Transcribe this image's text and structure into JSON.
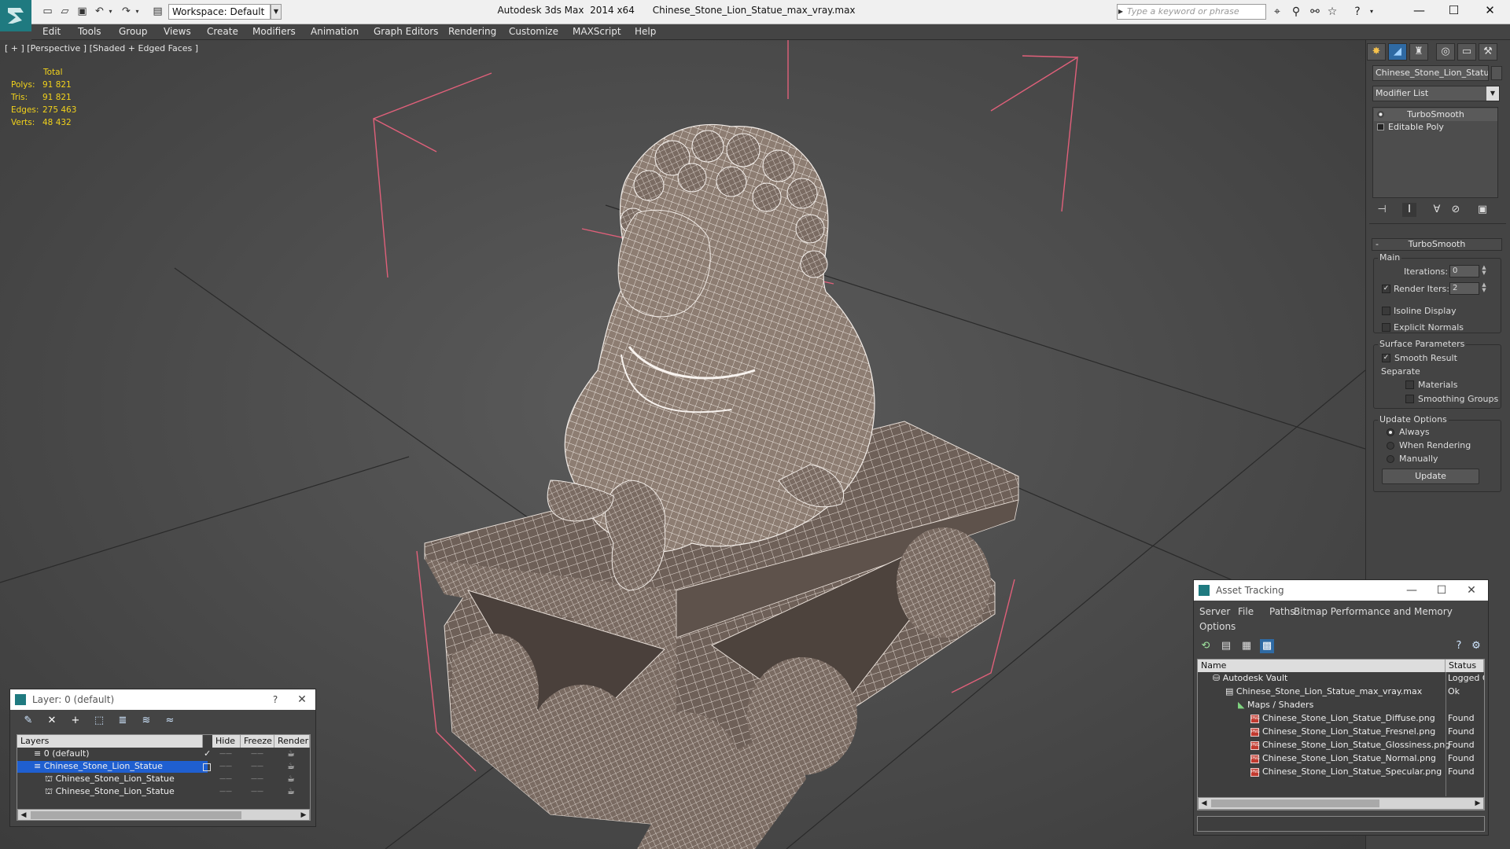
{
  "window": {
    "title": "Autodesk 3ds Max  2014 x64      Chinese_Stone_Lion_Statue_max_vray.max",
    "workspace": "Workspace: Default",
    "search_placeholder": "Type a keyword or phrase",
    "controls": {
      "minimize": "—",
      "maximize": "☐",
      "close": "✕"
    }
  },
  "menu": [
    "Edit",
    "Tools",
    "Group",
    "Views",
    "Create",
    "Modifiers",
    "Animation",
    "Graph Editors",
    "Rendering",
    "Customize",
    "MAXScript",
    "Help"
  ],
  "viewport": {
    "label": "[ + ] [Perspective ] [Shaded + Edged Faces ]",
    "stats": {
      "header": "Total",
      "rows": [
        {
          "label": "Polys:",
          "value": "91 821"
        },
        {
          "label": "Tris:",
          "value": "91 821"
        },
        {
          "label": "Edges:",
          "value": "275 463"
        },
        {
          "label": "Verts:",
          "value": "48 432"
        }
      ]
    }
  },
  "command_panel": {
    "object_name": "Chinese_Stone_Lion_Statue",
    "modifier_list": "Modifier List",
    "stack": [
      "TurboSmooth",
      "Editable Poly"
    ],
    "rollout_title": "TurboSmooth",
    "main": {
      "title": "Main",
      "iterations_label": "Iterations:",
      "iterations_value": "0",
      "render_iters_label": "Render Iters:",
      "render_iters_value": "2",
      "isoline_label": "Isoline Display",
      "explicit_normals_label": "Explicit Normals"
    },
    "surface": {
      "title": "Surface Parameters",
      "smooth_result": "Smooth Result",
      "separate": "Separate",
      "materials": "Materials",
      "smoothing_groups": "Smoothing Groups"
    },
    "update": {
      "title": "Update Options",
      "always": "Always",
      "when_rendering": "When Rendering",
      "manually": "Manually",
      "button": "Update"
    }
  },
  "layer_dialog": {
    "title": "Layer: 0 (default)",
    "help": "?",
    "close": "✕",
    "columns": [
      "Layers",
      "Hide",
      "Freeze",
      "Render"
    ],
    "rows": [
      "0 (default)",
      "Chinese_Stone_Lion_Statue",
      "Chinese_Stone_Lion_Statue",
      "Chinese_Stone_Lion_Statue"
    ],
    "dash": "——"
  },
  "asset_tracking": {
    "title": "Asset Tracking",
    "controls": {
      "minimize": "—",
      "maximize": "☐",
      "close": "✕"
    },
    "menu": [
      "Server",
      "File",
      "Paths",
      "Bitmap Performance and Memory",
      "Options"
    ],
    "columns": [
      "Name",
      "Status"
    ],
    "rows": [
      {
        "name": "Autodesk Vault",
        "status": "Logged O"
      },
      {
        "name": "Chinese_Stone_Lion_Statue_max_vray.max",
        "status": "Ok"
      },
      {
        "name": "Maps / Shaders",
        "status": ""
      },
      {
        "name": "Chinese_Stone_Lion_Statue_Diffuse.png",
        "status": "Found"
      },
      {
        "name": "Chinese_Stone_Lion_Statue_Fresnel.png",
        "status": "Found"
      },
      {
        "name": "Chinese_Stone_Lion_Statue_Glossiness.png",
        "status": "Found"
      },
      {
        "name": "Chinese_Stone_Lion_Statue_Normal.png",
        "status": "Found"
      },
      {
        "name": "Chinese_Stone_Lion_Statue_Specular.png",
        "status": "Found"
      }
    ],
    "png_tag": "PNG"
  },
  "colors": {
    "bounding_box": "#e0607a",
    "accent": "#1f7a80",
    "stats": "#f2d21b"
  }
}
